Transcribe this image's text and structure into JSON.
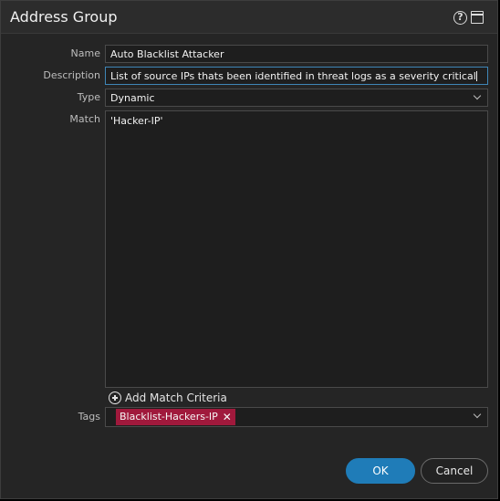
{
  "dialog": {
    "title": "Address Group",
    "icons": [
      "help-icon",
      "window-icon"
    ]
  },
  "form": {
    "name_label": "Name",
    "name_value": "Auto Blacklist Attacker",
    "description_label": "Description",
    "description_value": "List of source IPs thats been identified  in threat logs as a severity critical",
    "type_label": "Type",
    "type_value": "Dynamic",
    "match_label": "Match",
    "match_value": "'Hacker-IP'",
    "add_match_label": "Add Match Criteria",
    "tags_label": "Tags",
    "tags": [
      {
        "label": "Blacklist-Hackers-IP",
        "color": "#a0193c"
      }
    ]
  },
  "buttons": {
    "ok_label": "OK",
    "cancel_label": "Cancel"
  },
  "colors": {
    "accent": "#1f7cb8",
    "tag": "#a0193c",
    "background": "#252525"
  }
}
